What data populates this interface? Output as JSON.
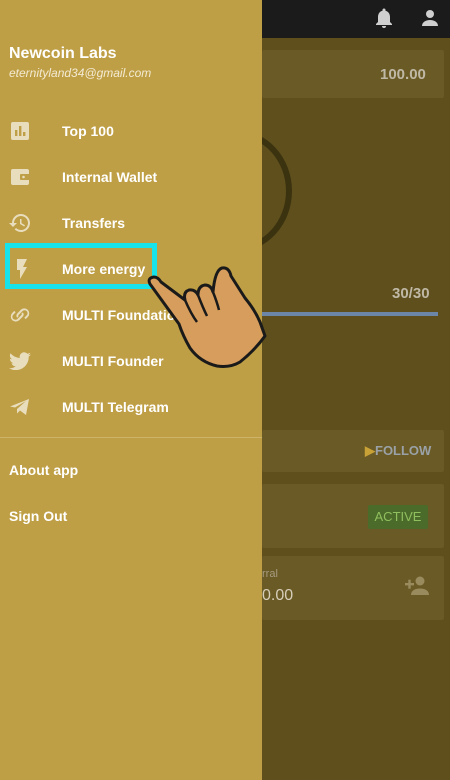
{
  "background": {
    "balance_value": "100.00",
    "energy_counter": "30/30",
    "follow_label": "FOLLOW",
    "status_badge": "ACTIVE",
    "referral_label": "rral",
    "referral_value": "0.00"
  },
  "drawer": {
    "user_name": "Newcoin Labs",
    "user_email": "eternityland34@gmail.com",
    "items": [
      {
        "label": "Top 100",
        "icon": "bar-chart-icon"
      },
      {
        "label": "Internal Wallet",
        "icon": "wallet-icon"
      },
      {
        "label": "Transfers",
        "icon": "history-icon"
      },
      {
        "label": "More energy",
        "icon": "lightning-icon"
      },
      {
        "label": "MULTI Foundation",
        "icon": "link-icon"
      },
      {
        "label": "MULTI Founder",
        "icon": "twitter-icon"
      },
      {
        "label": "MULTI Telegram",
        "icon": "telegram-icon"
      }
    ],
    "about_label": "About app",
    "signout_label": "Sign Out"
  },
  "colors": {
    "drawer_bg": "#bf9f45",
    "highlight": "#19e3ea",
    "topbar": "#1b1b1b"
  }
}
